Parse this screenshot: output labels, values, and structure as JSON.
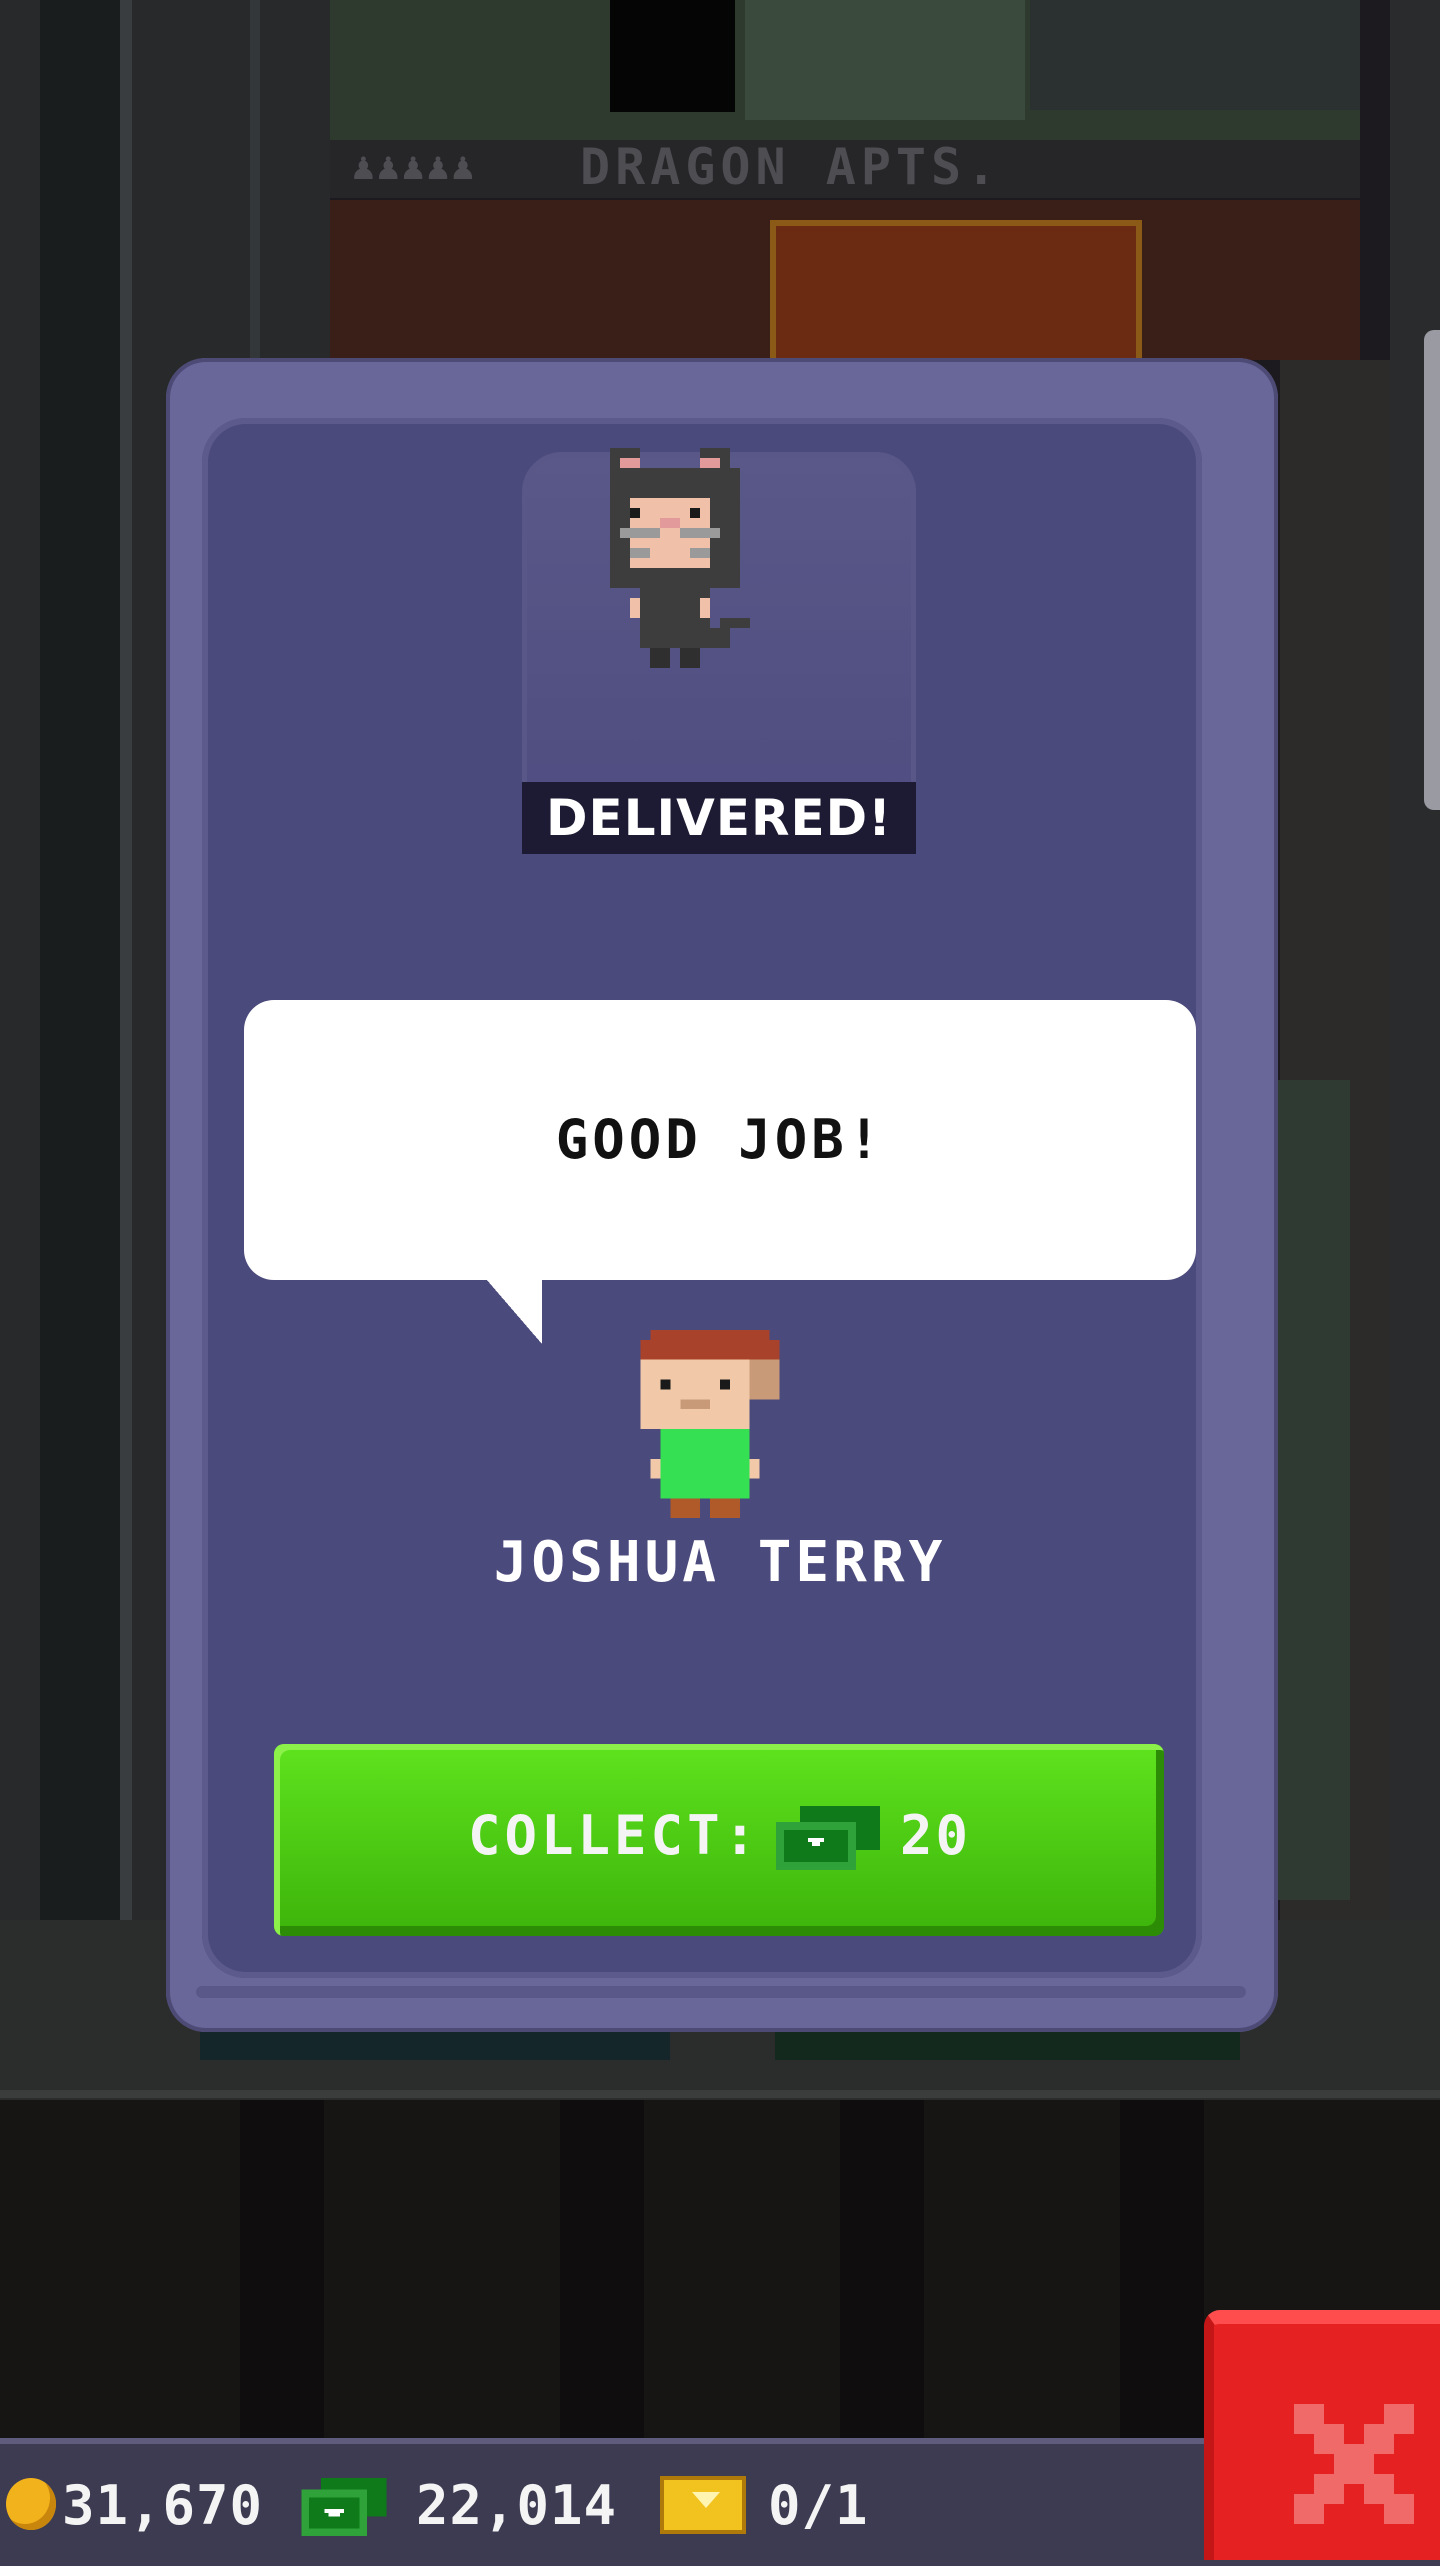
{
  "background": {
    "sign_text": "DRAGON APTS.",
    "sign_people": "♟♟♟♟♟"
  },
  "dialog": {
    "status_label": "DELIVERED!",
    "speech_text": "GOOD JOB!",
    "bitizen_name": "JOSHUA TERRY",
    "collect_label": "COLLECT:",
    "collect_amount": "20",
    "collect_currency_icon": "tower-bux-icon",
    "portrait_icon": "cat-costume-bitizen-icon",
    "bitizen_icon": "bitizen-green-shirt-icon"
  },
  "hud": {
    "coins": "31,670",
    "bux": "22,014",
    "tickets": "0/1",
    "coin_icon": "coin-icon",
    "bux_icon": "tower-bux-icon",
    "ticket_icon": "golden-ticket-icon"
  },
  "close_button": {
    "icon": "close-icon"
  },
  "colors": {
    "dialog_outer": "#69679a",
    "dialog_inner": "#4b4a7c",
    "collect_green": "#4fd014",
    "close_red": "#e62121",
    "hud_bar": "#3c3b52"
  }
}
